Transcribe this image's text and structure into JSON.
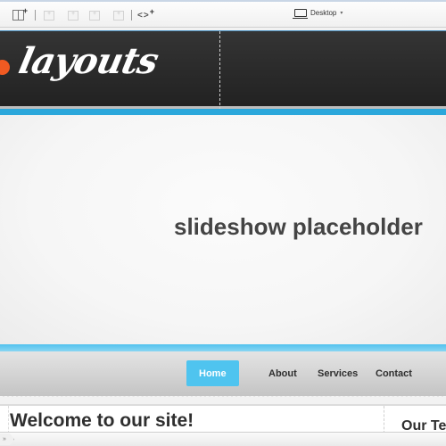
{
  "toolbar": {
    "buttons": [
      {
        "name": "add-panel",
        "icon": "panel-plus-icon",
        "enabled": true
      },
      {
        "name": "insert-left",
        "icon": "insert-left-icon",
        "enabled": false
      },
      {
        "name": "insert-right",
        "icon": "insert-right-icon",
        "enabled": false
      },
      {
        "name": "insert-below",
        "icon": "insert-below-icon",
        "enabled": false
      },
      {
        "name": "insert-above",
        "icon": "insert-above-icon",
        "enabled": false
      },
      {
        "name": "add-code",
        "icon": "code-plus-icon",
        "enabled": true
      }
    ],
    "code_glyph": "<>",
    "plus_glyph": "+",
    "device_label": "Desktop",
    "device_caret": "▾"
  },
  "site": {
    "logo_text": "layouts",
    "slideshow_text": "slideshow placeholder",
    "nav": [
      {
        "label": "Home",
        "active": true
      },
      {
        "label": "About",
        "active": false
      },
      {
        "label": "Services",
        "active": false
      },
      {
        "label": "Contact",
        "active": false
      }
    ],
    "welcome_heading": "Welcome to our site!",
    "sidebar_heading": "Our Te"
  },
  "statusbar": {
    "crumb_glyph": "»"
  },
  "colors": {
    "accent_blue": "#2ba7db",
    "nav_active": "#4fc4ef",
    "logo_dot": "#f05a22",
    "header_bg": "#2a2a2a"
  }
}
